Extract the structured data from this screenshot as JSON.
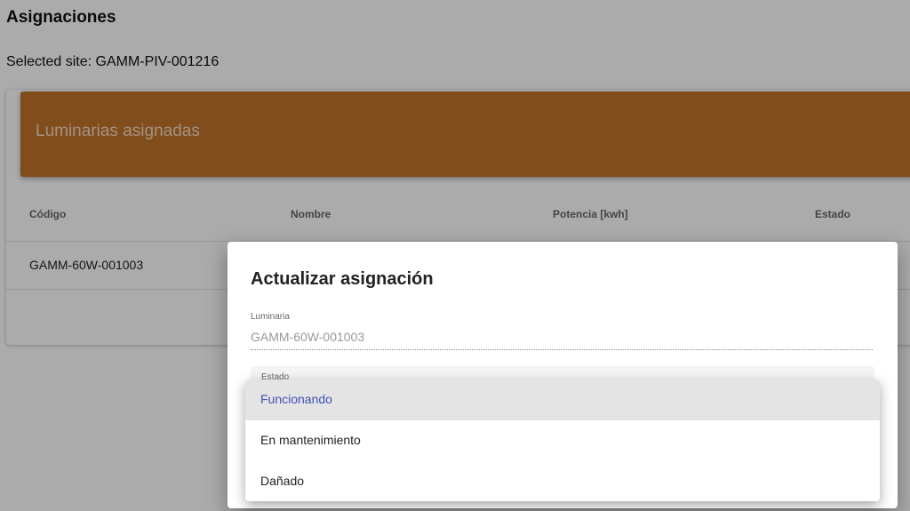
{
  "page": {
    "title": "Asignaciones",
    "selected_site": "Selected site: GAMM-PIV-001216"
  },
  "card": {
    "header_title": "Luminarias asignadas",
    "header_color": "#c0732b",
    "columns": [
      "Código",
      "Nombre",
      "Potencia [kwh]",
      "Estado"
    ],
    "rows": [
      {
        "codigo": "GAMM-60W-001003"
      }
    ]
  },
  "dialog": {
    "title": "Actualizar asignación",
    "luminaria_label": "Luminaria",
    "luminaria_value": "GAMM-60W-001003",
    "estado_label": "Estado"
  },
  "menu": {
    "options": [
      "Funcionando",
      "En mantenimiento",
      "Dañado"
    ],
    "selected": "Funcionando",
    "selected_color": "#3f51b5"
  }
}
